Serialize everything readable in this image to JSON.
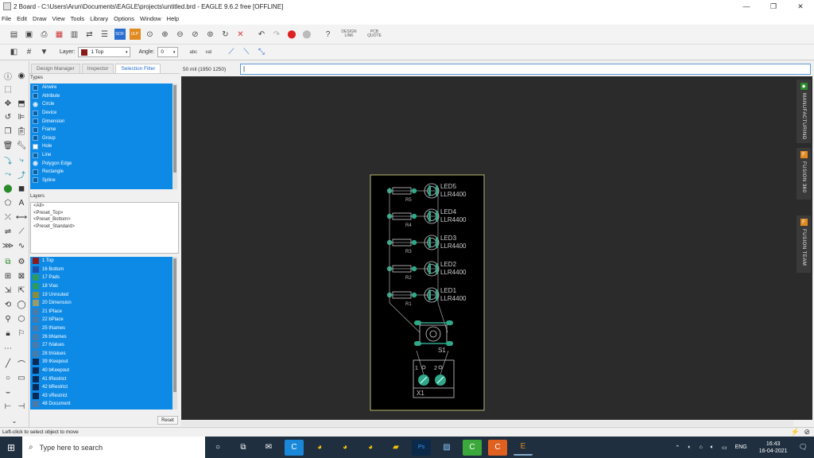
{
  "window": {
    "title": "2 Board - C:\\Users\\Arun\\Documents\\EAGLE\\projects\\untitled.brd - EAGLE 9.6.2 free [OFFLINE]",
    "minimize": "—",
    "maximize": "❐",
    "close": "✕"
  },
  "menu": [
    "File",
    "Edit",
    "Draw",
    "View",
    "Tools",
    "Library",
    "Options",
    "Window",
    "Help"
  ],
  "toolbar": {
    "design_link": "DESIGN LINK",
    "pcb_quote": "PCB QUOTE",
    "scr": "SCR",
    "ulp": "ULP"
  },
  "toolbar2": {
    "layer_label": "Layer:",
    "layer_value": "1 Top",
    "layer_color": "#8b1a1a",
    "angle_label": "Angle:",
    "angle_value": "0"
  },
  "panel": {
    "tabs": [
      "Design Manager",
      "Inspector",
      "Selection Filter"
    ],
    "types_label": "Types",
    "types": [
      "Airwire",
      "Attribute",
      "Circle",
      "Device",
      "Dimension",
      "Frame",
      "Group",
      "Hole",
      "Line",
      "Polygon Edge",
      "Rectangle",
      "Spline"
    ],
    "layers_label": "Layers",
    "presets": [
      "<All>",
      "<Preset_Top>",
      "<Preset_Bottom>",
      "<Preset_Standard>"
    ],
    "layers": [
      {
        "name": "1 Top",
        "color": "#8b1a1a"
      },
      {
        "name": "16 Bottom",
        "color": "#1e4fa8"
      },
      {
        "name": "17 Pads",
        "color": "#2e9a5e"
      },
      {
        "name": "18 Vias",
        "color": "#2e9a5e"
      },
      {
        "name": "19 Unrouted",
        "color": "#8b8b3a"
      },
      {
        "name": "20 Dimension",
        "color": "#9a9a6a"
      },
      {
        "name": "21 tPlace",
        "color": "#4a7aa8"
      },
      {
        "name": "22 bPlace",
        "color": "#4a7aa8"
      },
      {
        "name": "25 tNames",
        "color": "#4a7aa8"
      },
      {
        "name": "26 bNames",
        "color": "#4a7aa8"
      },
      {
        "name": "27 tValues",
        "color": "#4a7aa8"
      },
      {
        "name": "28 bValues",
        "color": "#4a7aa8"
      },
      {
        "name": "39 tKeepout",
        "color": "#0a2a55"
      },
      {
        "name": "40 bKeepout",
        "color": "#0a2a55"
      },
      {
        "name": "41 tRestrict",
        "color": "#0a2a55"
      },
      {
        "name": "42 bRestrict",
        "color": "#0a2a55"
      },
      {
        "name": "43 vRestrict",
        "color": "#0a2a55"
      },
      {
        "name": "48 Document",
        "color": "#4a7aa8"
      }
    ],
    "reset": "Reset"
  },
  "command": {
    "coord": "50 mil (1950 1250)",
    "value": "|"
  },
  "board": {
    "leds": [
      {
        "name": "LED5",
        "value": "LLR4400",
        "res": "R5"
      },
      {
        "name": "LED4",
        "value": "LLR4400",
        "res": "R4"
      },
      {
        "name": "LED3",
        "value": "LLR4400",
        "res": "R3"
      },
      {
        "name": "LED2",
        "value": "LLR4400",
        "res": "R2"
      },
      {
        "name": "LED1",
        "value": "LLR4400",
        "res": "R1"
      }
    ],
    "switch": "S1",
    "connector": "X1",
    "pin1": "1",
    "pin2": "2"
  },
  "right_tabs": [
    "MANUFACTURING",
    "FUSION 360",
    "FUSION TEAM"
  ],
  "status": "Left-click to select object to move",
  "taskbar": {
    "search": "Type here to search",
    "time": "16:43",
    "date": "16-04-2021",
    "lang": "ENG"
  }
}
